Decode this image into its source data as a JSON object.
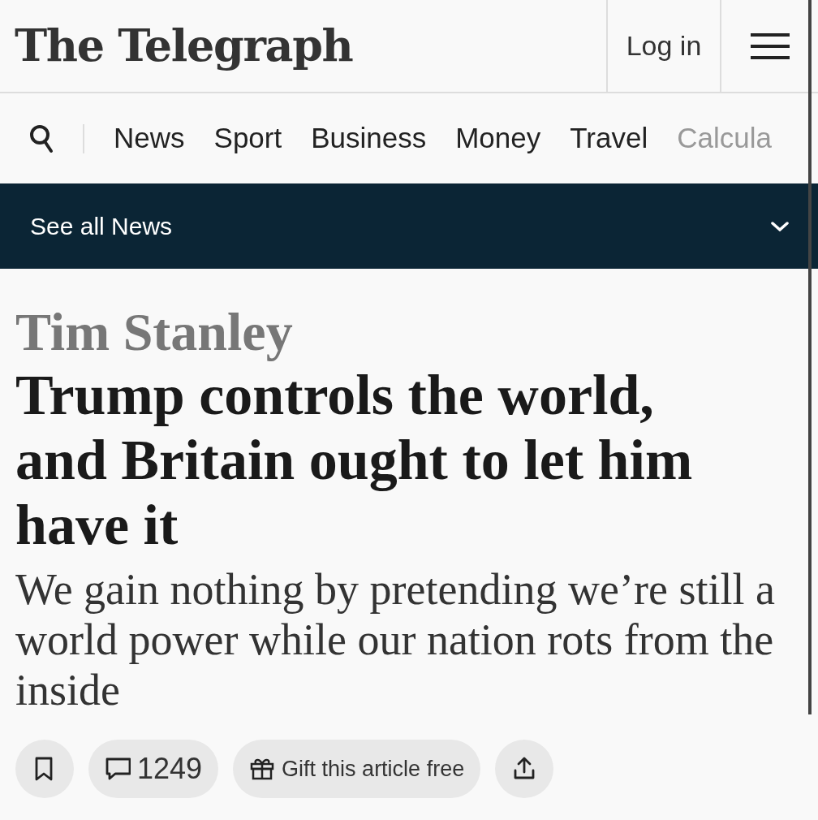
{
  "header": {
    "logo": "The Telegraph",
    "login": "Log in"
  },
  "nav": {
    "items": [
      {
        "label": "News",
        "faded": false
      },
      {
        "label": "Sport",
        "faded": false
      },
      {
        "label": "Business",
        "faded": false
      },
      {
        "label": "Money",
        "faded": false
      },
      {
        "label": "Travel",
        "faded": false
      },
      {
        "label": "Calcula",
        "faded": true
      }
    ]
  },
  "section_bar": {
    "label": "See all News"
  },
  "article": {
    "author": "Tim Stanley",
    "headline": "Trump controls the world, and Britain ought to let him have it",
    "standfirst": "We gain nothing by pretending we’re still a world power while our nation rots from the inside"
  },
  "actions": [
    {
      "kind": "bookmark"
    },
    {
      "kind": "comments",
      "label": "1249"
    },
    {
      "kind": "gift",
      "label": "Gift this article free"
    },
    {
      "kind": "share"
    }
  ]
}
